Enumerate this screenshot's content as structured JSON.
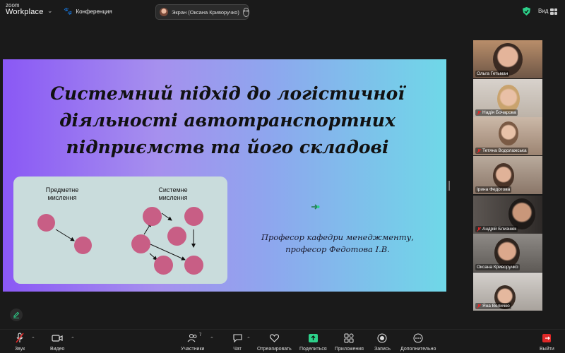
{
  "app": {
    "logo_top": "zoom",
    "logo_bottom": "Workplace"
  },
  "header": {
    "meeting_label": "Конференция",
    "screen_share_label": "Экран (Оксана Криворучко)",
    "view_label": "Вид"
  },
  "slide": {
    "title_lines": [
      "Системний підхід до логістичної",
      "діяльності автотранспортних",
      "підприємств та його складові"
    ],
    "diagram_left_label": [
      "Предметне",
      "мислення"
    ],
    "diagram_right_label": [
      "Системне",
      "мислення"
    ],
    "author_lines": [
      "Професор кафедри менеджменту,",
      "професор Федотова І.В."
    ]
  },
  "participants": [
    {
      "name": "Ольга Гетьман",
      "muted": false
    },
    {
      "name": "Надія Бочарова",
      "muted": true
    },
    {
      "name": "Тетяна Водолажська",
      "muted": true
    },
    {
      "name": "Ірина Федотова",
      "muted": false
    },
    {
      "name": "Андрій Близнюк",
      "muted": true
    },
    {
      "name": "Оксана Криворучко",
      "muted": false
    },
    {
      "name": "Яна Величко",
      "muted": true
    }
  ],
  "toolbar": {
    "audio": "Звук",
    "video": "Видео",
    "participants": "Участники",
    "participants_count": "7",
    "chat": "Чат",
    "react": "Отреагировать",
    "share": "Поделиться",
    "apps": "Приложения",
    "record": "Запись",
    "more": "Дополнительно",
    "leave": "Выйти"
  },
  "colors": {
    "accent_green": "#2dd18a",
    "mute_red": "#e02828",
    "slide_dot": "#c85e85"
  }
}
